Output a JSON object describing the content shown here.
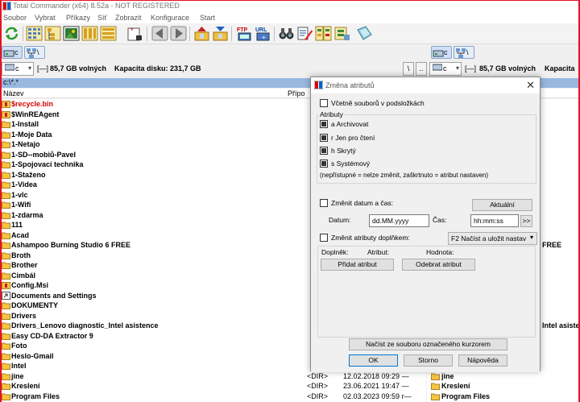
{
  "window": {
    "title": "Total Commander (x64) 8.52a - NOT REGISTERED"
  },
  "menu": [
    "Soubor",
    "Vybrat",
    "Příkazy",
    "Síť",
    "Zobrazit",
    "Konfigurace",
    "Start"
  ],
  "toolbar": {
    "icons": [
      "refresh-icon",
      "thumbnail-view-icon",
      "tree-view-icon",
      "image-view-icon",
      "details-icon",
      "list-icon",
      "invert-selection-icon",
      "back-icon",
      "forward-icon",
      "pack-icon",
      "unpack-icon",
      "ftp-icon",
      "url-icon",
      "binoculars-icon",
      "rename-icon",
      "compare-icon",
      "sync-icon",
      "notepad-icon"
    ],
    "ftp_label": "FTP",
    "url_label": "URL"
  },
  "left_panel": {
    "drive_letter": "c",
    "separator": "[—]",
    "free_space": "85,7 GB volných",
    "capacity": "Kapacita disku: 231,7 GB",
    "path": "c:\\*.*",
    "col_name": "Název",
    "col_ext": "Přípo",
    "files": [
      {
        "name": "$recycle.bin",
        "red": true
      },
      {
        "name": "$WinREAgent"
      },
      {
        "name": "1-Install"
      },
      {
        "name": "1-Moje Data"
      },
      {
        "name": "1-Netajo"
      },
      {
        "name": "1-SD--mobiů-Pavel"
      },
      {
        "name": "1-Spojovací technika"
      },
      {
        "name": "1-Staženo"
      },
      {
        "name": "1-Videa"
      },
      {
        "name": "1-vlc"
      },
      {
        "name": "1-Wifi"
      },
      {
        "name": "1-zdarma"
      },
      {
        "name": "111"
      },
      {
        "name": "Acad"
      },
      {
        "name": "Ashampoo Burning Studio 6 FREE"
      },
      {
        "name": "Broth"
      },
      {
        "name": "Brother"
      },
      {
        "name": "Cimbál"
      },
      {
        "name": "Config.Msi"
      },
      {
        "name": "Documents and Settings"
      },
      {
        "name": "DOKUMENTY"
      },
      {
        "name": "Drivers"
      },
      {
        "name": "Drivers_Lenovo diagnostic_Intel asistence"
      },
      {
        "name": "Easy CD-DA Extractor 9"
      },
      {
        "name": "Foto"
      },
      {
        "name": "Heslo-Gmail"
      },
      {
        "name": "Intel"
      },
      {
        "name": "jine",
        "dir": "<DIR>",
        "date": "12.02.2018 09:29 —"
      },
      {
        "name": "Kreslení",
        "dir": "<DIR>",
        "date": "23.06.2021 19:47 —"
      },
      {
        "name": "Program Files",
        "dir": "<DIR>",
        "date": "02.03.2023 09:59 r—"
      }
    ]
  },
  "right_panel": {
    "drive_letter": "c",
    "separator": "[—]",
    "free_space": "85,7 GB volných",
    "capacity": "Kapacita",
    "visible_files": [
      {
        "name": "Ashampoo Burning Studio 6 FREE",
        "row": 14
      },
      {
        "name": "Drivers_Lenovo diagnostic_Intel asistence",
        "row": 22
      },
      {
        "name": "jine",
        "row": 27
      },
      {
        "name": "Kreslení",
        "row": 28
      },
      {
        "name": "Program Files",
        "row": 29
      }
    ],
    "visible_truncated": [
      {
        "text": "FREE",
        "row": 14
      },
      {
        "text": "Intel asisten",
        "row": 22
      }
    ]
  },
  "dialog": {
    "title": "Změna atributů",
    "include_subfolders": "Včetně souborů v podsložkách",
    "attributes_label": "Atributy",
    "attr_archive": "a  Archivovat",
    "attr_readonly": "r  Jen pro čtení",
    "attr_hidden": "h  Skrytý",
    "attr_system": "s  Systémový",
    "attr_note": "(nepřístupné = nelze změnit, zaškrtnuto = atribut nastaven)",
    "change_datetime": "Změnit datum a čas:",
    "current_button": "Aktuální",
    "date_label": "Datum:",
    "date_value": "dd.MM.yyyy",
    "time_label": "Čas:",
    "time_value": "hh:mm:ss",
    "more_button": ">>",
    "change_by_plugin": "Změnit atributy doplňkem:",
    "plugin_dropdown": "F2 Načíst a uložit nastav",
    "plugin_col": "Doplněk:",
    "attribute_col": "Atribut:",
    "value_col": "Hodnota:",
    "add_attr": "Přidat atribut",
    "remove_attr": "Odebrat atribut",
    "load_from_file": "Načíst ze souboru označeného kurzorem",
    "ok": "OK",
    "cancel": "Storno",
    "help": "Nápověda"
  }
}
